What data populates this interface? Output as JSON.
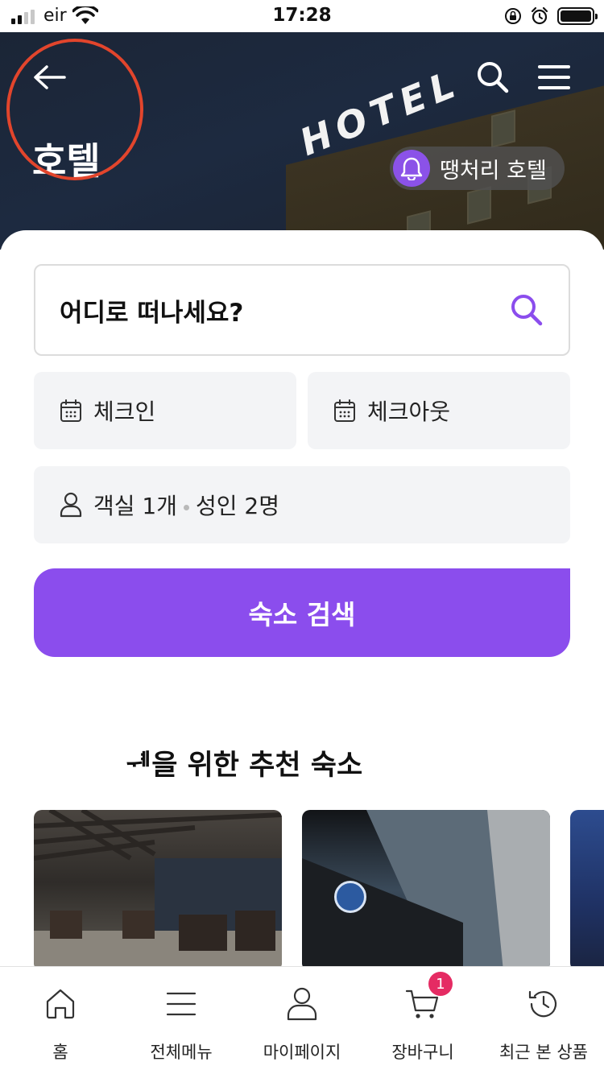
{
  "status_bar": {
    "carrier": "eir",
    "time": "17:28"
  },
  "header": {
    "title": "호텔",
    "deal_chip_label": "땡처리 호텔"
  },
  "search_form": {
    "destination_placeholder": "어디로 떠나세요?",
    "check_in_label": "체크인",
    "check_out_label": "체크아웃",
    "rooms_label": "객실 1개",
    "guests_label": "성인 2명",
    "submit_label": "숙소 검색"
  },
  "recommendations": {
    "section_title": "님을 위한 추천 숙소",
    "section_title_visible": "ᆌ을 위한 추천 숙소"
  },
  "tab_bar": {
    "items": [
      {
        "label": "홈",
        "icon": "home-icon"
      },
      {
        "label": "전체메뉴",
        "icon": "menu-icon"
      },
      {
        "label": "마이페이지",
        "icon": "person-icon"
      },
      {
        "label": "장바구니",
        "icon": "cart-icon",
        "badge": "1"
      },
      {
        "label": "최근 본 상품",
        "icon": "history-icon"
      }
    ]
  },
  "colors": {
    "accent": "#8b4ded",
    "badge": "#e52b63",
    "annotation": "#e2452c"
  }
}
